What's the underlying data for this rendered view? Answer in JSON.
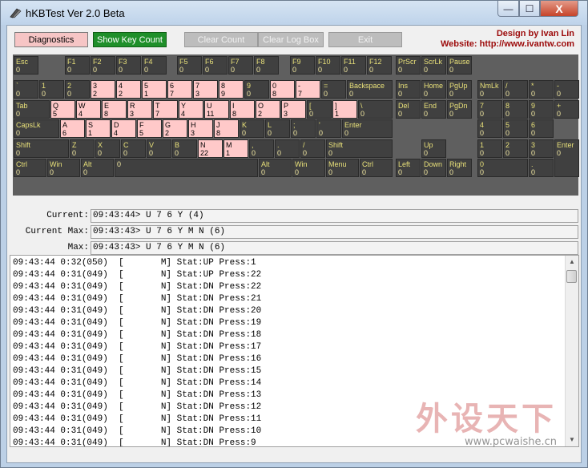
{
  "window": {
    "title": "hKBTest Ver 2.0 Beta",
    "minimize": "—",
    "maximize": "☐",
    "close": "X"
  },
  "toolbar": {
    "diagnostics": "Diagnostics",
    "show_key_count": "Show Key Count",
    "clear_count": "Clear Count",
    "clear_log_box": "Clear Log Box",
    "exit": "Exit"
  },
  "credits": {
    "design": "Design by Ivan Lin",
    "website": "Website: http://www.ivantw.com"
  },
  "keyboard": {
    "rows": [
      [
        [
          "Esc",
          "0"
        ],
        [
          "F1",
          "0"
        ],
        [
          "F2",
          "0"
        ],
        [
          "F3",
          "0"
        ],
        [
          "F4",
          "0"
        ],
        [
          "F5",
          "0"
        ],
        [
          "F6",
          "0"
        ],
        [
          "F7",
          "0"
        ],
        [
          "F8",
          "0"
        ],
        [
          "F9",
          "0"
        ],
        [
          "F10",
          "0"
        ],
        [
          "F11",
          "0"
        ],
        [
          "F12",
          "0"
        ],
        [
          "PrScr",
          "0"
        ],
        [
          "ScrLk",
          "0"
        ],
        [
          "Pause",
          "0"
        ]
      ],
      [
        [
          "`",
          "0"
        ],
        [
          "1",
          "0"
        ],
        [
          "2",
          "0"
        ],
        [
          "3",
          "2"
        ],
        [
          "4",
          "2"
        ],
        [
          "5",
          "1"
        ],
        [
          "6",
          "7"
        ],
        [
          "7",
          "3"
        ],
        [
          "8",
          "9"
        ],
        [
          "9",
          "0"
        ],
        [
          "0",
          "8"
        ],
        [
          "-",
          "7"
        ],
        [
          "=",
          "0"
        ],
        [
          "Backspace",
          "0"
        ],
        [
          "Ins",
          "0"
        ],
        [
          "Home",
          "0"
        ],
        [
          "PgUp",
          "0"
        ],
        [
          "NmLk",
          "0"
        ],
        [
          "/",
          "0"
        ],
        [
          "*",
          "0"
        ],
        [
          "-",
          "0"
        ]
      ],
      [
        [
          "Tab",
          "0"
        ],
        [
          "Q",
          "5"
        ],
        [
          "W",
          "4"
        ],
        [
          "E",
          "8"
        ],
        [
          "R",
          "3"
        ],
        [
          "T",
          "7"
        ],
        [
          "Y",
          "4"
        ],
        [
          "U",
          "11"
        ],
        [
          "I",
          "8"
        ],
        [
          "O",
          "2"
        ],
        [
          "P",
          "3"
        ],
        [
          "[",
          "0"
        ],
        [
          "]",
          "1"
        ],
        [
          "\\",
          "0"
        ],
        [
          "Del",
          "0"
        ],
        [
          "End",
          "0"
        ],
        [
          "PgDn",
          "0"
        ],
        [
          "7",
          "0"
        ],
        [
          "8",
          "0"
        ],
        [
          "9",
          "0"
        ],
        [
          "+",
          "0"
        ]
      ],
      [
        [
          "CapsLk",
          "0"
        ],
        [
          "A",
          "6"
        ],
        [
          "S",
          "1"
        ],
        [
          "D",
          "4"
        ],
        [
          "F",
          "5"
        ],
        [
          "G",
          "2"
        ],
        [
          "H",
          "3"
        ],
        [
          "J",
          "8"
        ],
        [
          "K",
          "0"
        ],
        [
          "L",
          "0"
        ],
        [
          ";",
          "0"
        ],
        [
          "'",
          "0"
        ],
        [
          "Enter",
          "0"
        ],
        [
          "4",
          "0"
        ],
        [
          "5",
          "0"
        ],
        [
          "6",
          "0"
        ]
      ],
      [
        [
          "Shift",
          "0"
        ],
        [
          "Z",
          "0"
        ],
        [
          "X",
          "0"
        ],
        [
          "C",
          "0"
        ],
        [
          "V",
          "0"
        ],
        [
          "B",
          "0"
        ],
        [
          "N",
          "22"
        ],
        [
          "M",
          "1"
        ],
        [
          ",",
          "0"
        ],
        [
          ".",
          "0"
        ],
        [
          "/",
          "0"
        ],
        [
          "Shift",
          "0"
        ],
        [
          "Up",
          "0"
        ],
        [
          "1",
          "0"
        ],
        [
          "2",
          "0"
        ],
        [
          "3",
          "0"
        ],
        [
          "Enter",
          "0"
        ]
      ],
      [
        [
          "Ctrl",
          "0"
        ],
        [
          "Win",
          "0"
        ],
        [
          "Alt",
          "0"
        ],
        [
          "",
          "0"
        ],
        [
          "Alt",
          "0"
        ],
        [
          "Win",
          "0"
        ],
        [
          "Menu",
          "0"
        ],
        [
          "Ctrl",
          "0"
        ],
        [
          "Left",
          "0"
        ],
        [
          "Down",
          "0"
        ],
        [
          "Right",
          "0"
        ],
        [
          "0",
          "0"
        ],
        [
          ".",
          "0"
        ]
      ]
    ]
  },
  "status": {
    "current_label": "Current:",
    "current": "09:43:44> U 7 6 Y (4)",
    "current_max_label": "Current Max:",
    "current_max": "09:43:43> U 7 6 Y M N (6)",
    "max_label": "Max:",
    "max": "09:43:43> U 7 6 Y M N (6)"
  },
  "log": [
    "09:43:44 0:32(050)  [       M] Stat:UP Press:1",
    "09:43:44 0:31(049)  [       N] Stat:UP Press:22",
    "09:43:44 0:31(049)  [       N] Stat:DN Press:22",
    "09:43:44 0:31(049)  [       N] Stat:DN Press:21",
    "09:43:44 0:31(049)  [       N] Stat:DN Press:20",
    "09:43:44 0:31(049)  [       N] Stat:DN Press:19",
    "09:43:44 0:31(049)  [       N] Stat:DN Press:18",
    "09:43:44 0:31(049)  [       N] Stat:DN Press:17",
    "09:43:44 0:31(049)  [       N] Stat:DN Press:16",
    "09:43:44 0:31(049)  [       N] Stat:DN Press:15",
    "09:43:44 0:31(049)  [       N] Stat:DN Press:14",
    "09:43:44 0:31(049)  [       N] Stat:DN Press:13",
    "09:43:44 0:31(049)  [       N] Stat:DN Press:12",
    "09:43:44 0:31(049)  [       N] Stat:DN Press:11",
    "09:43:44 0:31(049)  [       N] Stat:DN Press:10",
    "09:43:44 0:31(049)  [       N] Stat:DN Press:9"
  ],
  "watermark": {
    "cn": "外设天下",
    "url": "www.pcwaishe.cn"
  },
  "colors": {
    "highlight": "#ffc9c9",
    "key": "#404040",
    "keyboard_bg": "#5f5f5f",
    "key_text": "#e8e079",
    "credit": "#9c0a0a",
    "show_btn": "#1f8f2a"
  }
}
